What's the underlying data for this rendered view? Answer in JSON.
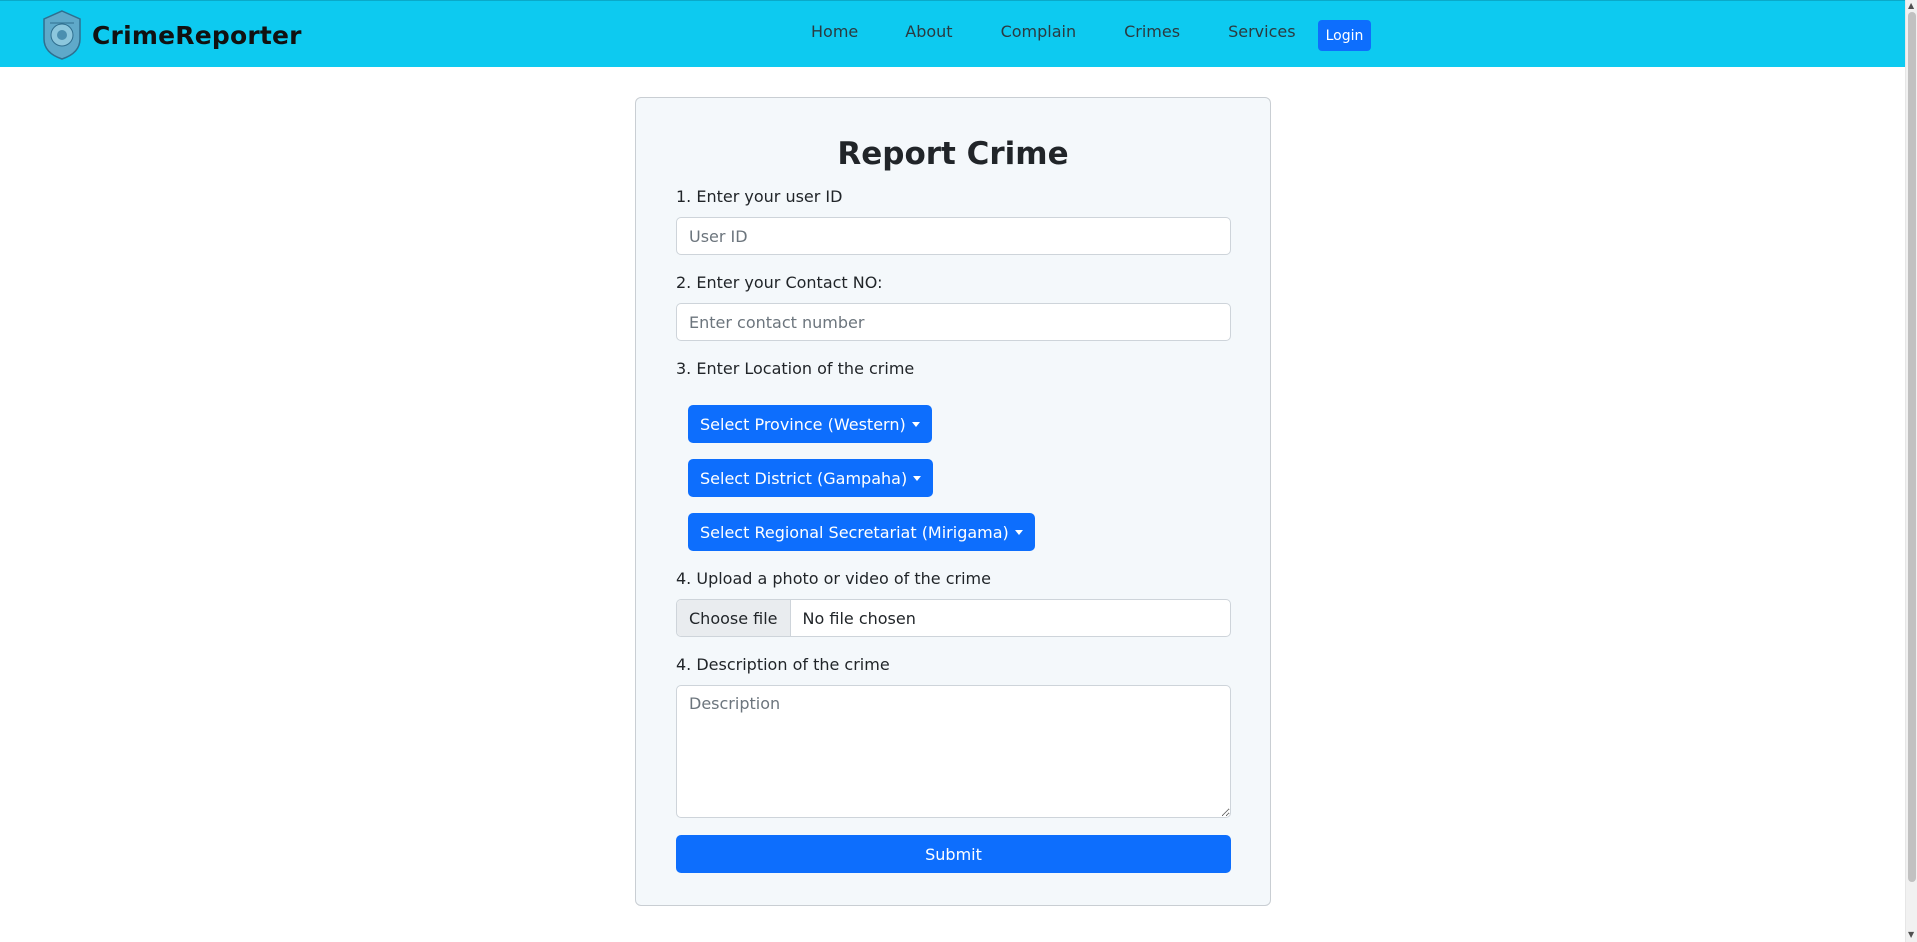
{
  "brand": {
    "name": "CrimeReporter",
    "logo_icon": "police-emblem-icon"
  },
  "nav": {
    "links": [
      "Home",
      "About",
      "Complain",
      "Crimes",
      "Services"
    ],
    "login_label": "Login"
  },
  "form": {
    "title": "Report Crime",
    "user_id": {
      "label": "1. Enter your user ID",
      "placeholder": "User ID",
      "value": ""
    },
    "contact": {
      "label": "2. Enter your Contact NO:",
      "placeholder": "Enter contact number",
      "value": ""
    },
    "location": {
      "label": "3. Enter Location of the crime",
      "province_button": "Select Province (Western)",
      "district_button": "Select District (Gampaha)",
      "secretariat_button": "Select Regional Secretariat (Mirigama)"
    },
    "upload": {
      "label": "4. Upload a photo or video of the crime",
      "button": "Choose file",
      "status": "No file chosen"
    },
    "description": {
      "label": "4. Description of the crime",
      "placeholder": "Description",
      "value": ""
    },
    "submit_label": "Submit"
  },
  "colors": {
    "navbar": "#0dcaf0",
    "primary": "#0d6efd",
    "card_bg": "#f4f8fb"
  }
}
